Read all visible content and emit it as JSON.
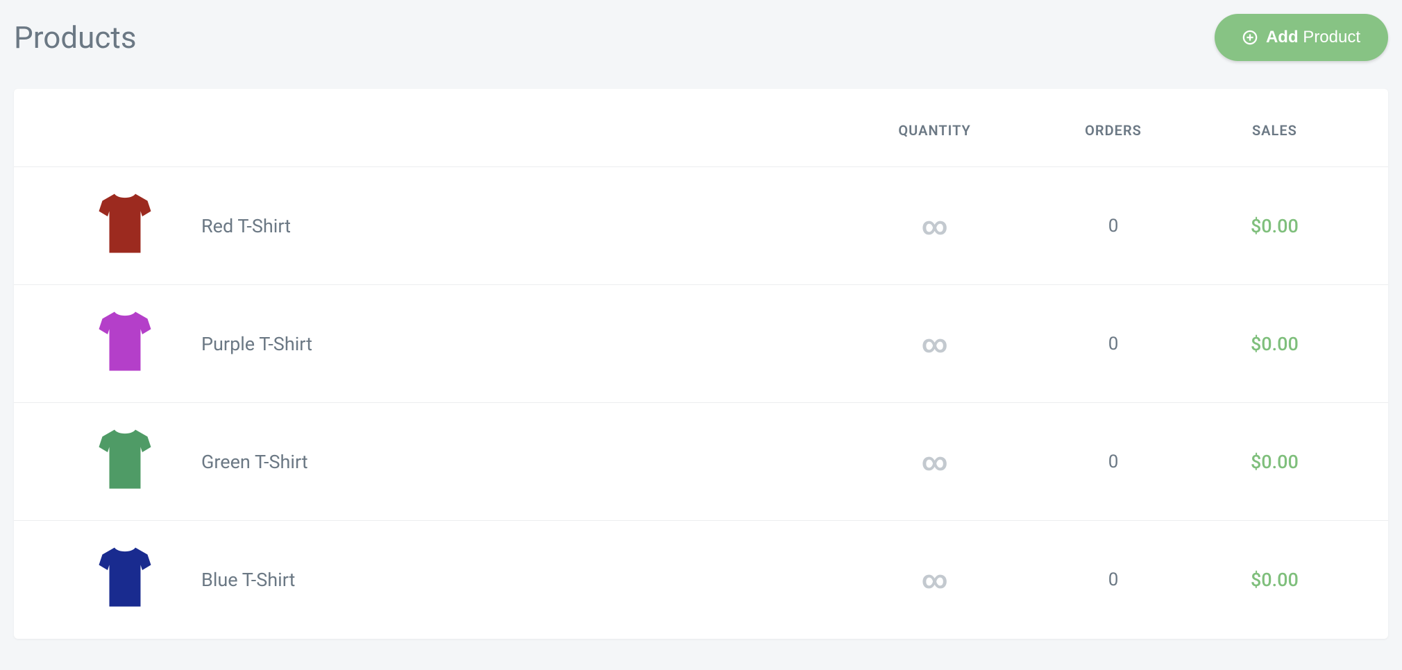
{
  "header": {
    "title": "Products",
    "add_button_bold": "Add",
    "add_button_rest": " Product"
  },
  "columns": {
    "quantity": "QUANTITY",
    "orders": "ORDERS",
    "sales": "SALES"
  },
  "products": [
    {
      "name": "Red T-Shirt",
      "color": "#9c2a1f",
      "quantity": "∞",
      "orders": "0",
      "sales": "$0.00"
    },
    {
      "name": "Purple T-Shirt",
      "color": "#b43fc9",
      "quantity": "∞",
      "orders": "0",
      "sales": "$0.00"
    },
    {
      "name": "Green T-Shirt",
      "color": "#4f9b66",
      "quantity": "∞",
      "orders": "0",
      "sales": "$0.00"
    },
    {
      "name": "Blue T-Shirt",
      "color": "#192b8f",
      "quantity": "∞",
      "orders": "0",
      "sales": "$0.00"
    }
  ]
}
